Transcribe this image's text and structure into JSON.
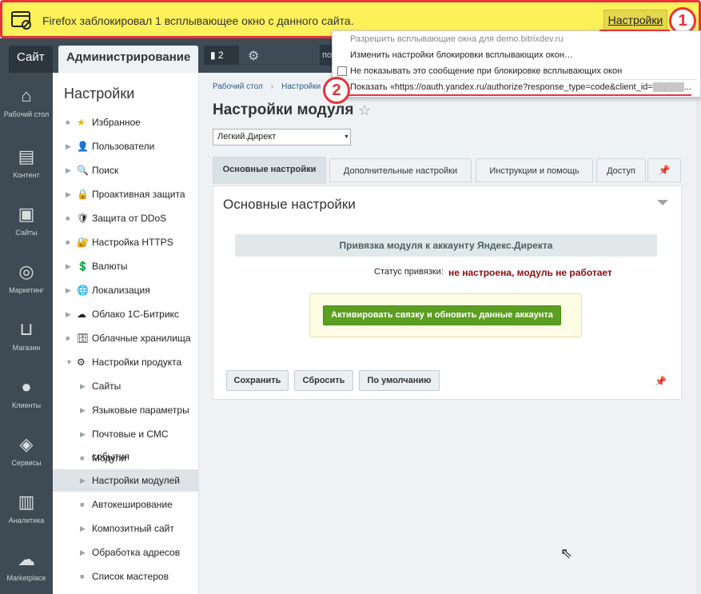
{
  "firefox_bar": {
    "message": "Firefox заблокировал 1 всплывающее окно с данного сайта.",
    "settings_label": "Настройки",
    "badge": "1"
  },
  "popup_menu": {
    "items": [
      "Разрешить всплывающие окна для demo.bitrixdev.ru",
      "Изменить настройки блокировки всплывающих окон…",
      "Не показывать это сообщение при блокировке всплывающих окон",
      "Показать «https://oauth.yandex.ru/authorize?response_type=code&client_id=▒▒▒▒▒..."
    ],
    "badge": "2"
  },
  "top_panel": {
    "site_tab": "Сайт",
    "admin_tab": "Администрирование",
    "notifications": "2",
    "search_stub": "по"
  },
  "icon_sidebar": [
    {
      "label": "Рабочий стол",
      "icon": "home-icon"
    },
    {
      "label": "Контент",
      "icon": "document-icon"
    },
    {
      "label": "Сайты",
      "icon": "calendar-24-icon"
    },
    {
      "label": "Маркетинг",
      "icon": "target-icon"
    },
    {
      "label": "Магазин",
      "icon": "basket-icon"
    },
    {
      "label": "Клиенты",
      "icon": "clients-24-icon"
    },
    {
      "label": "Сервисы",
      "icon": "layers-icon"
    },
    {
      "label": "Аналитика",
      "icon": "bar-chart-icon"
    },
    {
      "label": "Marketplace",
      "icon": "cloud-download-icon"
    }
  ],
  "menu": {
    "title": "Настройки",
    "items": [
      {
        "label": "Избранное",
        "icon": "★"
      },
      {
        "label": "Пользователи",
        "icon": "👤"
      },
      {
        "label": "Поиск",
        "icon": "🔍"
      },
      {
        "label": "Проактивная защита",
        "icon": "🔒"
      },
      {
        "label": "Защита от DDoS",
        "icon": "🛡"
      },
      {
        "label": "Настройка HTTPS",
        "icon": "🔐"
      },
      {
        "label": "Валюты",
        "icon": "💲"
      },
      {
        "label": "Локализация",
        "icon": "🌐"
      },
      {
        "label": "Облако 1С-Битрикс",
        "icon": "☁"
      },
      {
        "label": "Облачные хранилища",
        "icon": "🗄"
      },
      {
        "label": "Настройки продукта",
        "icon": "⚙"
      },
      {
        "label": "Сайты"
      },
      {
        "label": "Языковые параметры"
      },
      {
        "label": "Почтовые и СМС события"
      },
      {
        "label": "Модули"
      },
      {
        "label": "Настройки модулей"
      },
      {
        "label": "Автокеширование"
      },
      {
        "label": "Композитный сайт"
      },
      {
        "label": "Обработка адресов"
      },
      {
        "label": "Список мастеров"
      }
    ]
  },
  "breadcrumbs": [
    "Рабочий стол",
    "Настройки"
  ],
  "page": {
    "title": "Настройки модуля",
    "module_select": "Легкий.Директ"
  },
  "tabs": [
    "Основные настройки",
    "Дополнительные настройки",
    "Инструкции и помощь",
    "Доступ"
  ],
  "panel": {
    "title": "Основные настройки",
    "section_heading": "Привязка модуля к аккаунту Яндекс.Директа",
    "status_label": "Статус привязки:",
    "status_value": "не настроена, модуль не работает",
    "activate_button": "Активировать связку и обновить данные аккаунта",
    "save": "Сохранить",
    "reset": "Сбросить",
    "default": "По умолчанию"
  }
}
